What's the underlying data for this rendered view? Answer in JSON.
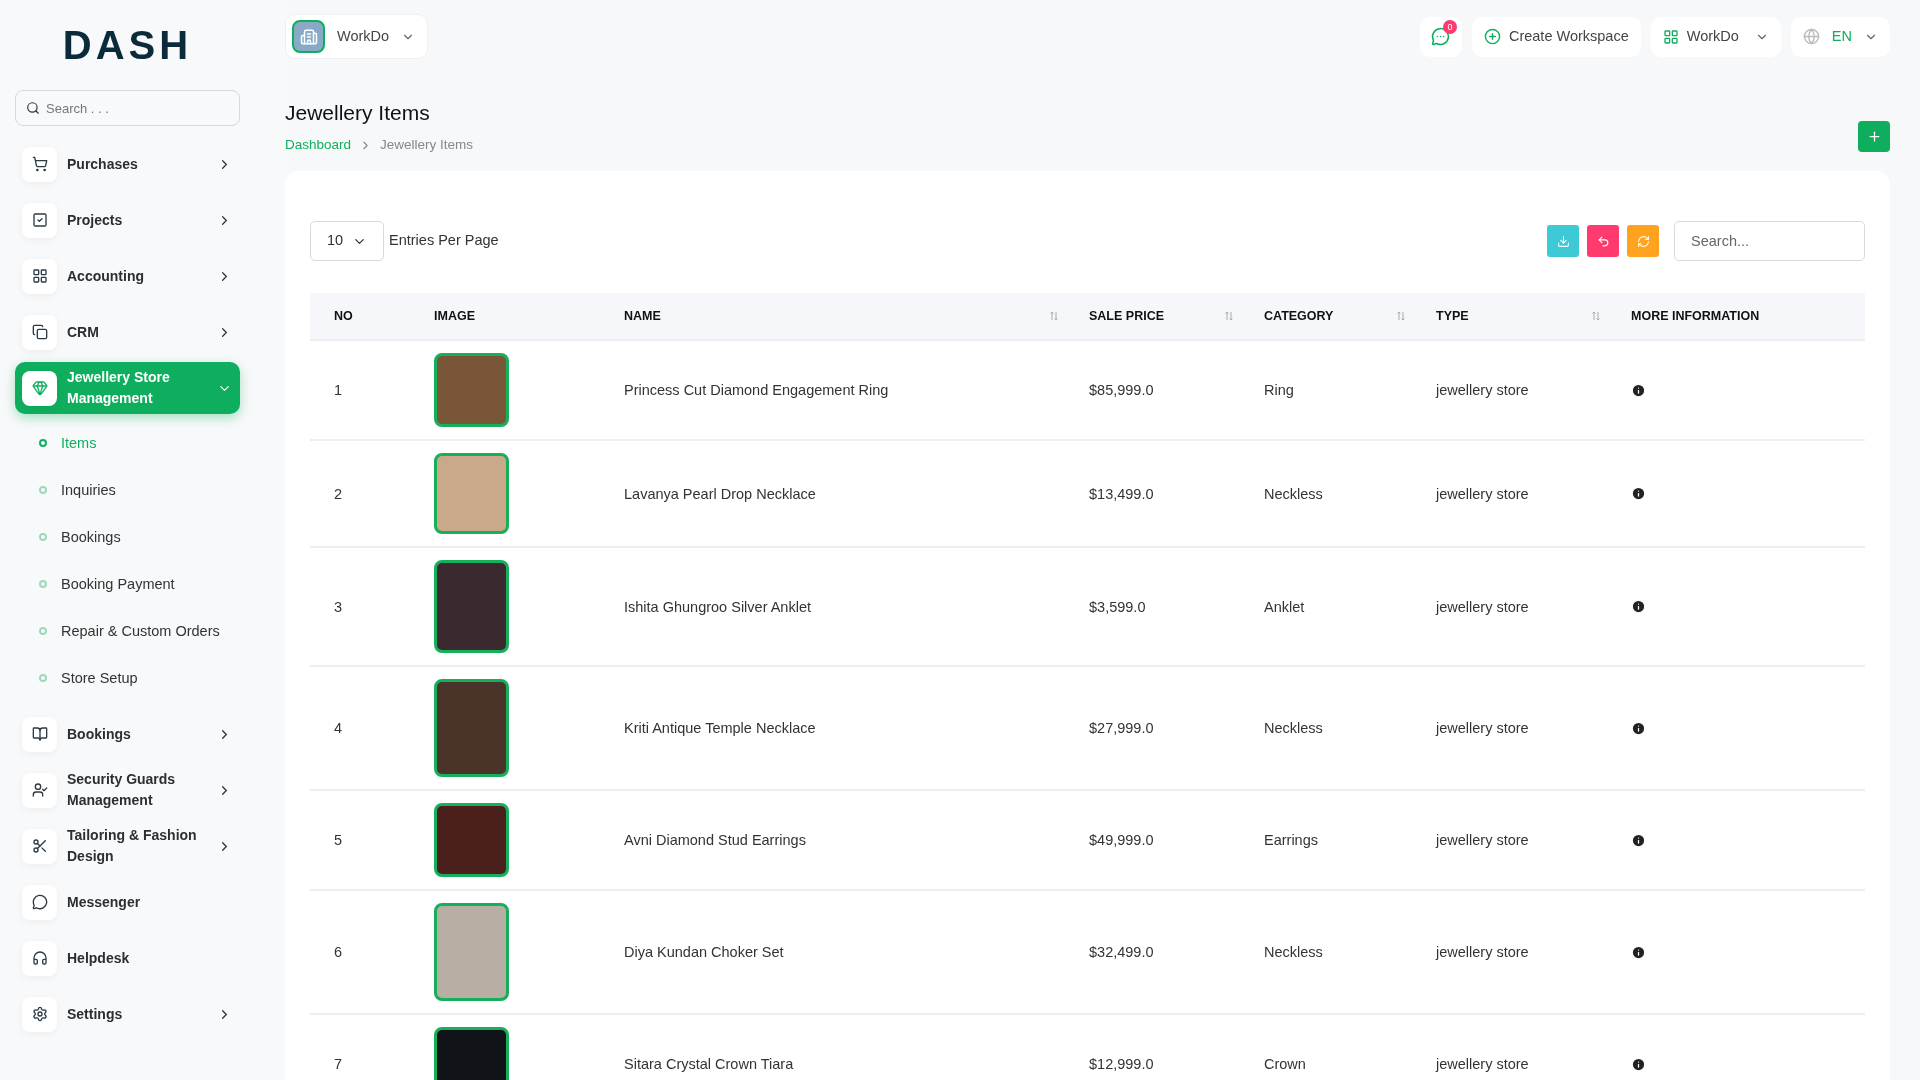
{
  "logo": "DASH",
  "sidebar": {
    "search": {
      "placeholder": "Search . . ."
    },
    "items": [
      {
        "label": "Purchases",
        "kind": "group",
        "expanded": false,
        "selected": false
      },
      {
        "label": "Projects",
        "kind": "group",
        "expanded": false,
        "selected": false
      },
      {
        "label": "Accounting",
        "kind": "group",
        "expanded": false,
        "selected": false
      },
      {
        "label": "CRM",
        "kind": "group",
        "expanded": false,
        "selected": false
      },
      {
        "label": "Jewellery Store Management",
        "kind": "group",
        "expanded": true,
        "selected": true,
        "children": [
          {
            "label": "Items",
            "selected": true
          },
          {
            "label": "Inquiries",
            "selected": false
          },
          {
            "label": "Bookings",
            "selected": false
          },
          {
            "label": "Booking Payment",
            "selected": false
          },
          {
            "label": "Repair & Custom Orders",
            "selected": false
          },
          {
            "label": "Store Setup",
            "selected": false
          }
        ]
      },
      {
        "label": "Bookings",
        "kind": "group",
        "expanded": false,
        "selected": false
      },
      {
        "label": "Security Guards Management",
        "kind": "group",
        "expanded": false,
        "selected": false
      },
      {
        "label": "Tailoring & Fashion Design",
        "kind": "group",
        "expanded": false,
        "selected": false
      },
      {
        "label": "Messenger",
        "kind": "link",
        "selected": false
      },
      {
        "label": "Helpdesk",
        "kind": "link",
        "selected": false
      },
      {
        "label": "Settings",
        "kind": "group",
        "expanded": false,
        "selected": false
      }
    ]
  },
  "topbar": {
    "workspace": "WorkDo",
    "message_count": "0",
    "create_workspace": "Create Workspace",
    "workspace_menu": "WorkDo",
    "language": "EN"
  },
  "page": {
    "title": "Jewellery Items",
    "breadcrumb": [
      "Dashboard",
      "Jewellery Items"
    ]
  },
  "table_controls": {
    "entries": "10",
    "entries_label": "Entries Per Page",
    "search_placeholder": "Search..."
  },
  "table": {
    "columns": [
      {
        "label": "NO",
        "sortable": false
      },
      {
        "label": "IMAGE",
        "sortable": false
      },
      {
        "label": "NAME",
        "sortable": true
      },
      {
        "label": "SALE PRICE",
        "sortable": true
      },
      {
        "label": "CATEGORY",
        "sortable": true
      },
      {
        "label": "TYPE",
        "sortable": true
      },
      {
        "label": "MORE INFORMATION",
        "sortable": false
      }
    ],
    "rows": [
      {
        "no": "1",
        "name": "Princess Cut Diamond Engagement Ring",
        "sale_price": "$85,999.0",
        "category": "Ring",
        "type": "jewellery store"
      },
      {
        "no": "2",
        "name": "Lavanya Pearl Drop Necklace",
        "sale_price": "$13,499.0",
        "category": "Neckless",
        "type": "jewellery store"
      },
      {
        "no": "3",
        "name": "Ishita Ghungroo Silver Anklet",
        "sale_price": "$3,599.0",
        "category": "Anklet",
        "type": "jewellery store"
      },
      {
        "no": "4",
        "name": "Kriti Antique Temple Necklace",
        "sale_price": "$27,999.0",
        "category": "Neckless",
        "type": "jewellery store"
      },
      {
        "no": "5",
        "name": "Avni Diamond Stud Earrings",
        "sale_price": "$49,999.0",
        "category": "Earrings",
        "type": "jewellery store"
      },
      {
        "no": "6",
        "name": "Diya Kundan Choker Set",
        "sale_price": "$32,499.0",
        "category": "Neckless",
        "type": "jewellery store"
      },
      {
        "no": "7",
        "name": "Sitara Crystal Crown Tiara",
        "sale_price": "$12,999.0",
        "category": "Crown",
        "type": "jewellery store"
      }
    ]
  }
}
